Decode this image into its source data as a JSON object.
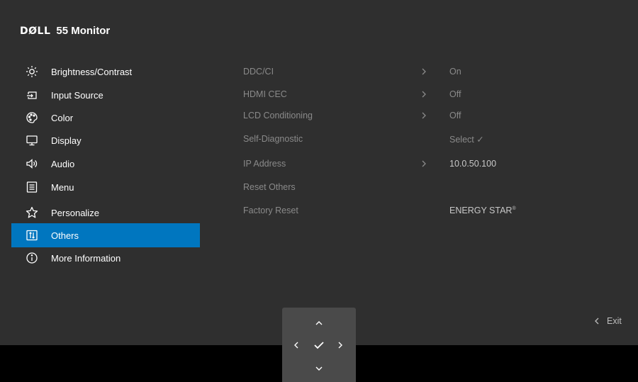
{
  "header": {
    "brand": "DØLL",
    "model": "55 Monitor"
  },
  "menu": {
    "items": [
      {
        "label": "Brightness/Contrast",
        "icon": "brightness-icon"
      },
      {
        "label": "Input Source",
        "icon": "input-source-icon"
      },
      {
        "label": "Color",
        "icon": "color-palette-icon"
      },
      {
        "label": "Display",
        "icon": "display-icon"
      },
      {
        "label": "Audio",
        "icon": "speaker-icon"
      },
      {
        "label": "Menu",
        "icon": "menu-icon"
      },
      {
        "label": "Personalize",
        "icon": "star-icon"
      },
      {
        "label": "Others",
        "icon": "others-icon",
        "selected": true
      },
      {
        "label": "More Information",
        "icon": "info-icon"
      }
    ],
    "selected_color": "#0076bf"
  },
  "settings": {
    "rows": [
      {
        "label": "DDC/CI",
        "has_arrow": true,
        "value": "On"
      },
      {
        "label": "HDMI CEC",
        "has_arrow": true,
        "value": "Off"
      },
      {
        "label": "LCD Conditioning",
        "has_arrow": true,
        "value": "Off"
      },
      {
        "label": "Self-Diagnostic",
        "has_arrow": false,
        "value": "Select ✓"
      },
      {
        "label": "IP Address",
        "has_arrow": true,
        "value": "10.0.50.100"
      },
      {
        "label": "Reset Others",
        "has_arrow": false,
        "value": ""
      },
      {
        "label": "Factory Reset",
        "has_arrow": false,
        "value": "ENERGY STAR",
        "value_sup": "®"
      }
    ]
  },
  "navigation": {
    "up": "chevron-up-icon",
    "left": "chevron-left-icon",
    "ok": "checkmark-icon",
    "right": "chevron-right-icon",
    "down": "chevron-down-icon"
  },
  "footer": {
    "exit_label": "Exit"
  }
}
